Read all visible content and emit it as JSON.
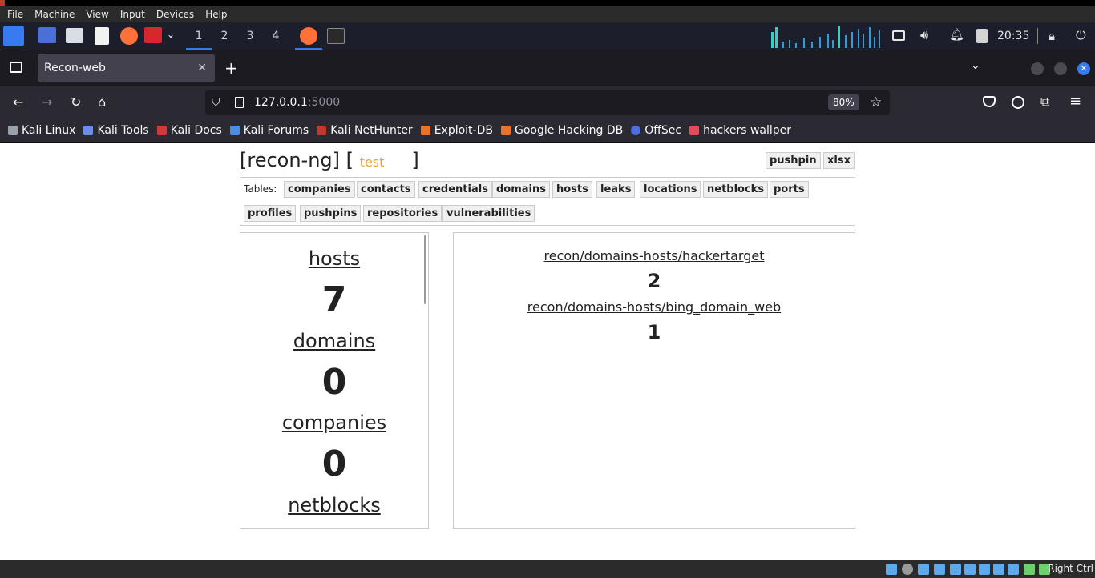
{
  "vbox": {
    "menu": [
      "File",
      "Machine",
      "View",
      "Input",
      "Devices",
      "Help"
    ],
    "host_key": "Right Ctrl"
  },
  "panel": {
    "workspaces": [
      "1",
      "2",
      "3",
      "4"
    ],
    "clock": "20:35"
  },
  "browser": {
    "tab_title": "Recon-web",
    "url_host": "127.0.0.1",
    "url_port": ":5000",
    "zoom": "80%",
    "bookmarks": [
      "Kali Linux",
      "Kali Tools",
      "Kali Docs",
      "Kali Forums",
      "Kali NetHunter",
      "Exploit-DB",
      "Google Hacking DB",
      "OffSec",
      "hackers wallper"
    ]
  },
  "page": {
    "title_prefix": "[recon-ng] [",
    "workspace": "test",
    "title_suffix": "]",
    "export": [
      "pushpin",
      "xlsx"
    ],
    "tables_label": "Tables:",
    "tables": [
      "companies",
      "contacts",
      "credentials",
      "domains",
      "hosts",
      "leaks",
      "locations",
      "netblocks",
      "ports",
      "profiles",
      "pushpins",
      "repositories",
      "vulnerabilities"
    ],
    "stats": [
      {
        "name": "hosts",
        "value": "7"
      },
      {
        "name": "domains",
        "value": "0"
      },
      {
        "name": "companies",
        "value": "0"
      },
      {
        "name": "netblocks",
        "value": ""
      }
    ],
    "modules": [
      {
        "name": "recon/domains-hosts/hackertarget",
        "value": "2"
      },
      {
        "name": "recon/domains-hosts/bing_domain_web",
        "value": "1"
      }
    ]
  }
}
